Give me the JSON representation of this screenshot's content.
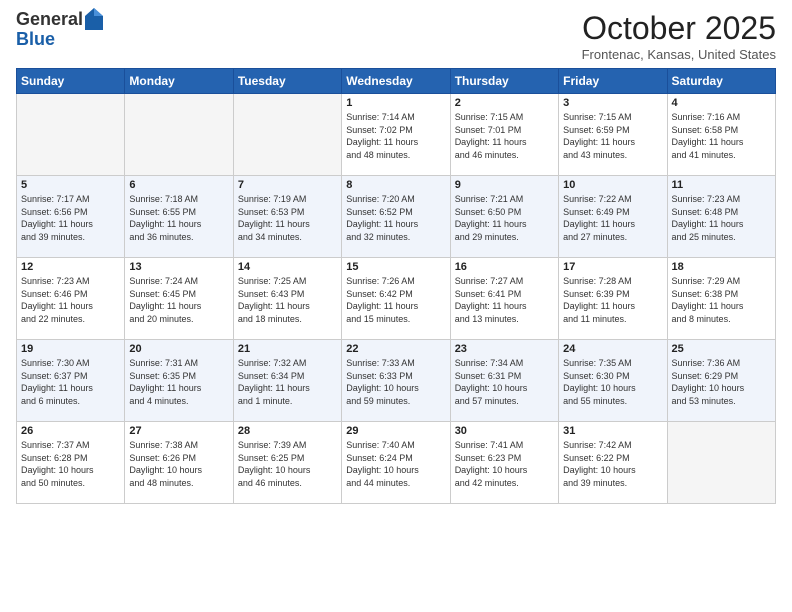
{
  "logo": {
    "general": "General",
    "blue": "Blue"
  },
  "header": {
    "month_title": "October 2025",
    "subtitle": "Frontenac, Kansas, United States"
  },
  "weekdays": [
    "Sunday",
    "Monday",
    "Tuesday",
    "Wednesday",
    "Thursday",
    "Friday",
    "Saturday"
  ],
  "weeks": [
    [
      {
        "day": "",
        "info": ""
      },
      {
        "day": "",
        "info": ""
      },
      {
        "day": "",
        "info": ""
      },
      {
        "day": "1",
        "info": "Sunrise: 7:14 AM\nSunset: 7:02 PM\nDaylight: 11 hours\nand 48 minutes."
      },
      {
        "day": "2",
        "info": "Sunrise: 7:15 AM\nSunset: 7:01 PM\nDaylight: 11 hours\nand 46 minutes."
      },
      {
        "day": "3",
        "info": "Sunrise: 7:15 AM\nSunset: 6:59 PM\nDaylight: 11 hours\nand 43 minutes."
      },
      {
        "day": "4",
        "info": "Sunrise: 7:16 AM\nSunset: 6:58 PM\nDaylight: 11 hours\nand 41 minutes."
      }
    ],
    [
      {
        "day": "5",
        "info": "Sunrise: 7:17 AM\nSunset: 6:56 PM\nDaylight: 11 hours\nand 39 minutes."
      },
      {
        "day": "6",
        "info": "Sunrise: 7:18 AM\nSunset: 6:55 PM\nDaylight: 11 hours\nand 36 minutes."
      },
      {
        "day": "7",
        "info": "Sunrise: 7:19 AM\nSunset: 6:53 PM\nDaylight: 11 hours\nand 34 minutes."
      },
      {
        "day": "8",
        "info": "Sunrise: 7:20 AM\nSunset: 6:52 PM\nDaylight: 11 hours\nand 32 minutes."
      },
      {
        "day": "9",
        "info": "Sunrise: 7:21 AM\nSunset: 6:50 PM\nDaylight: 11 hours\nand 29 minutes."
      },
      {
        "day": "10",
        "info": "Sunrise: 7:22 AM\nSunset: 6:49 PM\nDaylight: 11 hours\nand 27 minutes."
      },
      {
        "day": "11",
        "info": "Sunrise: 7:23 AM\nSunset: 6:48 PM\nDaylight: 11 hours\nand 25 minutes."
      }
    ],
    [
      {
        "day": "12",
        "info": "Sunrise: 7:23 AM\nSunset: 6:46 PM\nDaylight: 11 hours\nand 22 minutes."
      },
      {
        "day": "13",
        "info": "Sunrise: 7:24 AM\nSunset: 6:45 PM\nDaylight: 11 hours\nand 20 minutes."
      },
      {
        "day": "14",
        "info": "Sunrise: 7:25 AM\nSunset: 6:43 PM\nDaylight: 11 hours\nand 18 minutes."
      },
      {
        "day": "15",
        "info": "Sunrise: 7:26 AM\nSunset: 6:42 PM\nDaylight: 11 hours\nand 15 minutes."
      },
      {
        "day": "16",
        "info": "Sunrise: 7:27 AM\nSunset: 6:41 PM\nDaylight: 11 hours\nand 13 minutes."
      },
      {
        "day": "17",
        "info": "Sunrise: 7:28 AM\nSunset: 6:39 PM\nDaylight: 11 hours\nand 11 minutes."
      },
      {
        "day": "18",
        "info": "Sunrise: 7:29 AM\nSunset: 6:38 PM\nDaylight: 11 hours\nand 8 minutes."
      }
    ],
    [
      {
        "day": "19",
        "info": "Sunrise: 7:30 AM\nSunset: 6:37 PM\nDaylight: 11 hours\nand 6 minutes."
      },
      {
        "day": "20",
        "info": "Sunrise: 7:31 AM\nSunset: 6:35 PM\nDaylight: 11 hours\nand 4 minutes."
      },
      {
        "day": "21",
        "info": "Sunrise: 7:32 AM\nSunset: 6:34 PM\nDaylight: 11 hours\nand 1 minute."
      },
      {
        "day": "22",
        "info": "Sunrise: 7:33 AM\nSunset: 6:33 PM\nDaylight: 10 hours\nand 59 minutes."
      },
      {
        "day": "23",
        "info": "Sunrise: 7:34 AM\nSunset: 6:31 PM\nDaylight: 10 hours\nand 57 minutes."
      },
      {
        "day": "24",
        "info": "Sunrise: 7:35 AM\nSunset: 6:30 PM\nDaylight: 10 hours\nand 55 minutes."
      },
      {
        "day": "25",
        "info": "Sunrise: 7:36 AM\nSunset: 6:29 PM\nDaylight: 10 hours\nand 53 minutes."
      }
    ],
    [
      {
        "day": "26",
        "info": "Sunrise: 7:37 AM\nSunset: 6:28 PM\nDaylight: 10 hours\nand 50 minutes."
      },
      {
        "day": "27",
        "info": "Sunrise: 7:38 AM\nSunset: 6:26 PM\nDaylight: 10 hours\nand 48 minutes."
      },
      {
        "day": "28",
        "info": "Sunrise: 7:39 AM\nSunset: 6:25 PM\nDaylight: 10 hours\nand 46 minutes."
      },
      {
        "day": "29",
        "info": "Sunrise: 7:40 AM\nSunset: 6:24 PM\nDaylight: 10 hours\nand 44 minutes."
      },
      {
        "day": "30",
        "info": "Sunrise: 7:41 AM\nSunset: 6:23 PM\nDaylight: 10 hours\nand 42 minutes."
      },
      {
        "day": "31",
        "info": "Sunrise: 7:42 AM\nSunset: 6:22 PM\nDaylight: 10 hours\nand 39 minutes."
      },
      {
        "day": "",
        "info": ""
      }
    ]
  ]
}
